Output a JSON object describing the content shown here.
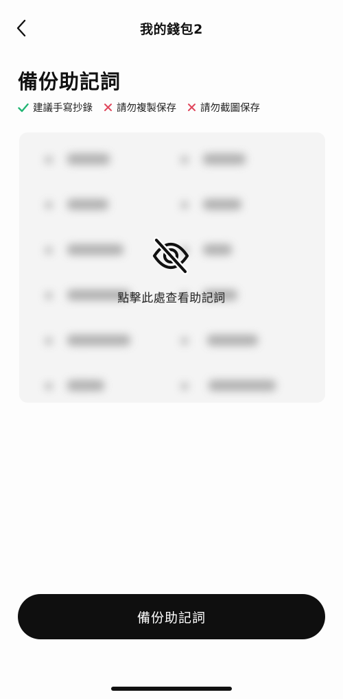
{
  "nav": {
    "title": "我的錢包2"
  },
  "page": {
    "title": "備份助記詞"
  },
  "tips": [
    {
      "label": "建議手寫抄錄",
      "type": "allowed"
    },
    {
      "label": "請勿複製保存",
      "type": "forbidden"
    },
    {
      "label": "請勿截圖保存",
      "type": "forbidden"
    }
  ],
  "reveal": {
    "text": "點擊此處查看助記詞"
  },
  "actions": {
    "backup_label": "備份助記詞"
  },
  "colors": {
    "check": "#21b573",
    "cross": "#e0465c",
    "button_bg": "#0f0f0f",
    "card_bg": "#f4f4f4"
  }
}
